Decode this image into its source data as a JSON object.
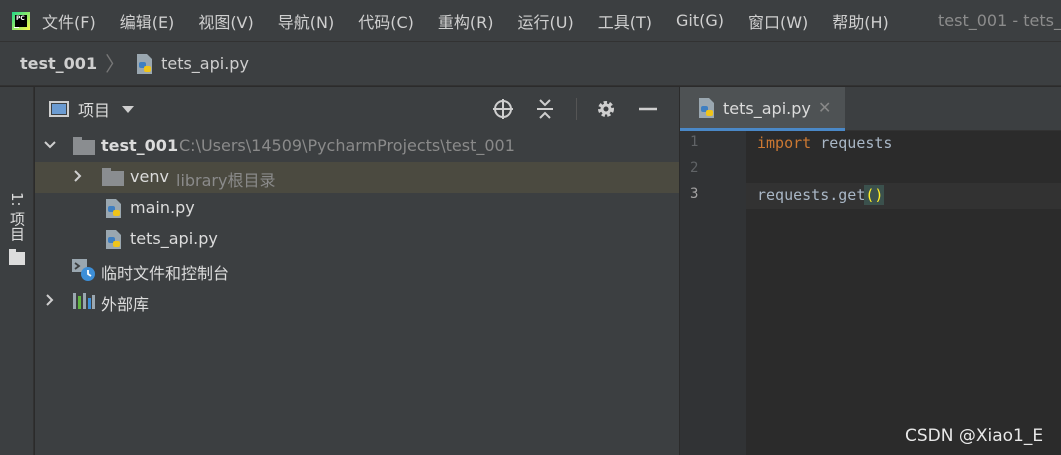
{
  "menubar": {
    "items": [
      "文件(F)",
      "编辑(E)",
      "视图(V)",
      "导航(N)",
      "代码(C)",
      "重构(R)",
      "运行(U)",
      "工具(T)",
      "Git(G)",
      "窗口(W)",
      "帮助(H)"
    ],
    "window_title": "test_001 - tets_"
  },
  "navbar": {
    "project": "test_001",
    "file": "tets_api.py"
  },
  "left_stripe": {
    "project_tab": "1: 项目"
  },
  "project_panel": {
    "title": "项目",
    "tree": [
      {
        "label": "test_001",
        "path": "C:\\Users\\14509\\PycharmProjects\\test_001"
      },
      {
        "label": "venv",
        "path": "library根目录"
      },
      {
        "label": "main.py"
      },
      {
        "label": "tets_api.py"
      },
      {
        "label": "临时文件和控制台"
      },
      {
        "label": "外部库"
      }
    ]
  },
  "editor": {
    "tab_label": "tets_api.py",
    "line_numbers": [
      "1",
      "2",
      "3"
    ],
    "code": {
      "line1_kw": "import",
      "line1_rest": " requests",
      "line3_main": "requests.get",
      "line3_open": "(",
      "line3_close": ")"
    }
  },
  "watermark": "CSDN @Xiao1_E",
  "colors": {
    "accent": "#4a88c7",
    "keyword": "#cc7832",
    "selection": "#4b4a40"
  }
}
